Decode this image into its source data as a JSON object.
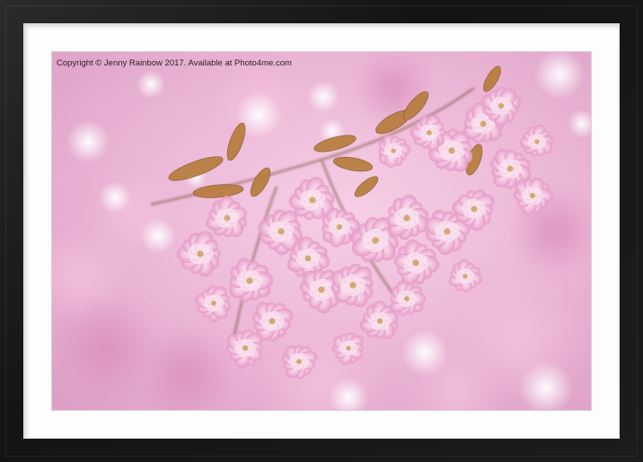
{
  "photo": {
    "subject": "pink cherry blossoms",
    "watermark": "Copyright  © Jenny Rainbow  2017. Available at Photo4me.com"
  },
  "colors": {
    "frame": "#1a1a1a",
    "mount": "#fdfdfd",
    "blossom_light": "#f8d4ea",
    "blossom_mid": "#eeaad0",
    "blossom_deep": "#d880b4",
    "leaf": "#b07a3a",
    "bokeh": "#ffffff"
  }
}
